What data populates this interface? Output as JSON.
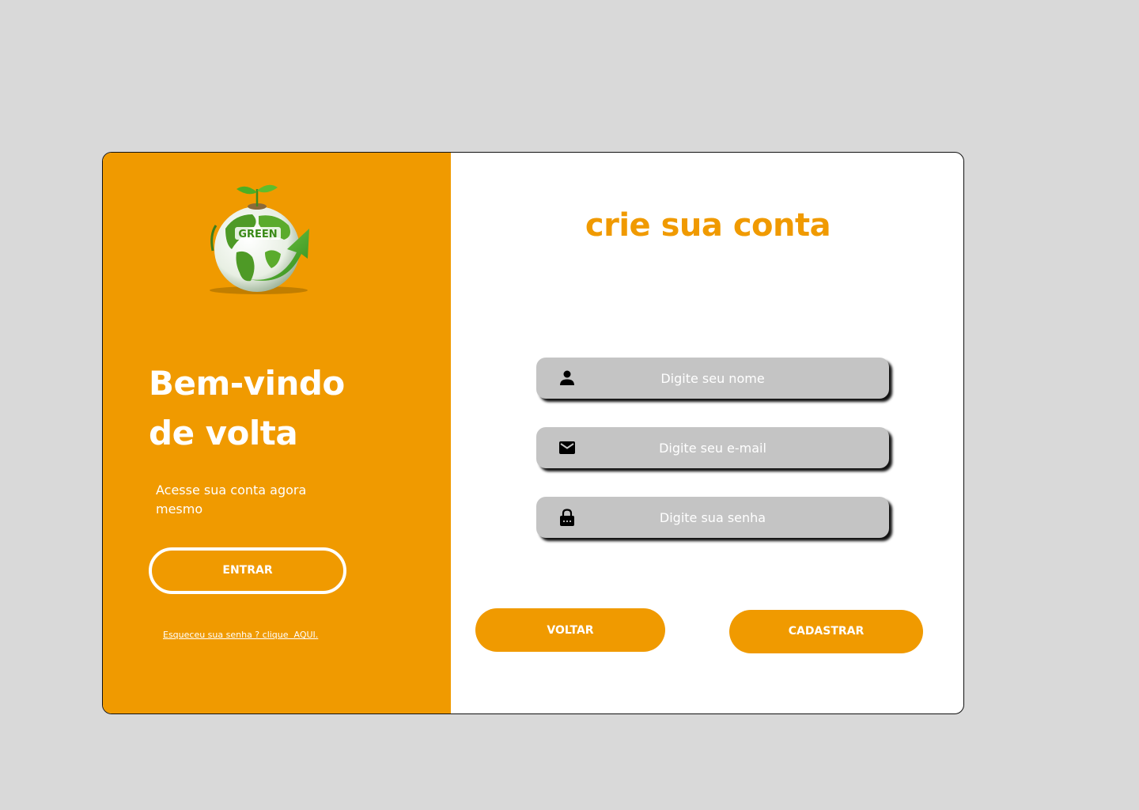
{
  "left_panel": {
    "logo_text": "GREEN",
    "welcome_line1": "Bem-vindo",
    "welcome_line2": "de volta",
    "subtitle": "Acesse sua conta agora mesmo",
    "enter_button": "ENTRAR",
    "forgot_link": "Esqueceu sua senha ? clique  AQUI."
  },
  "right_panel": {
    "title": "crie sua conta",
    "fields": {
      "name": {
        "placeholder": "Digite seu nome",
        "icon": "person-icon"
      },
      "email": {
        "placeholder": "Digite seu e-mail",
        "icon": "mail-icon"
      },
      "password": {
        "placeholder": "Digite sua senha",
        "icon": "lock-icon"
      }
    },
    "back_button": "VOLTAR",
    "register_button": "CADASTRAR"
  },
  "colors": {
    "accent": "#f09a00",
    "background": "#d9d9d9",
    "field_bg": "#c4c4c4",
    "text_light": "#ffffff"
  }
}
